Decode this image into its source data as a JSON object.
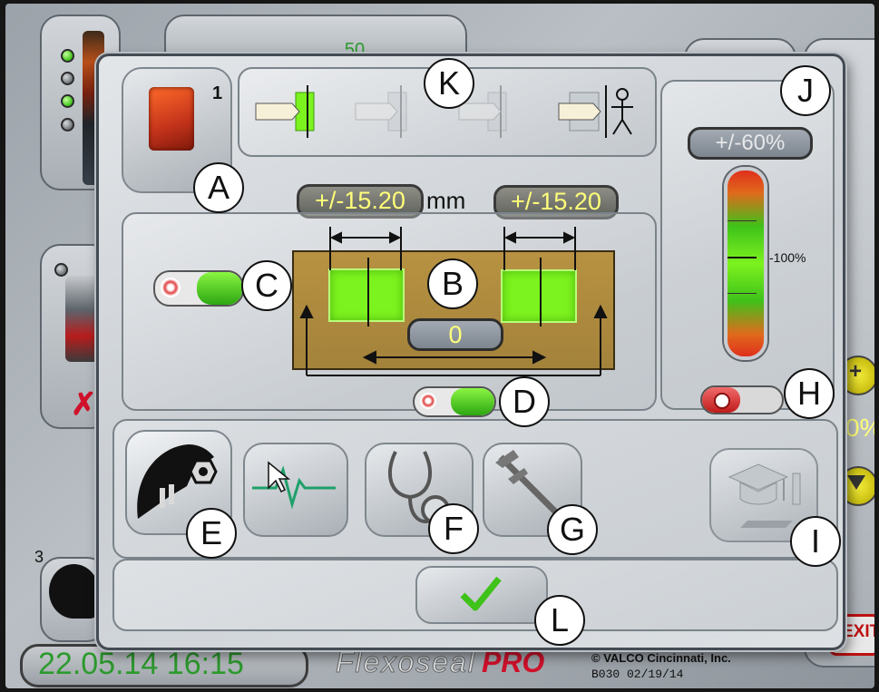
{
  "background": {
    "top_value": "50",
    "right_percent": "0%",
    "row_number": "3",
    "datetime": "22.05.14 16:15",
    "brand": "Flexoseal",
    "brand_pro": "PRO",
    "copyright": "© VALCO Cincinnati, Inc.",
    "version": "B030 02/19/14",
    "exit_label": "EXIT",
    "lamps": [
      "on",
      "off",
      "on",
      "off"
    ]
  },
  "dialog": {
    "sensor_number": "1",
    "tolerance_left": "+/-15.20",
    "unit": "mm",
    "tolerance_right": "+/-15.20",
    "offset_value": "0",
    "percent_range": "+/-60%",
    "scale_label": "-100%",
    "callouts": {
      "a": "A",
      "b": "B",
      "c": "C",
      "d": "D",
      "e": "E",
      "f": "F",
      "g": "G",
      "h": "H",
      "i": "I",
      "j": "J",
      "k": "K",
      "l": "L"
    }
  },
  "colors": {
    "accent_green": "#7cf21e",
    "pill_text": "#ffff7a",
    "datetime_text": "#2d9a2d",
    "brand_red": "#d0112b",
    "plate": "#ad8a3c"
  }
}
